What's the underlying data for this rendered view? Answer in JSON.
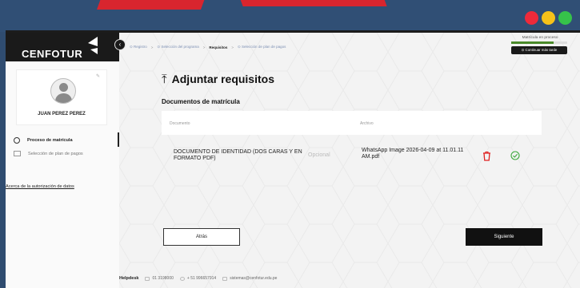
{
  "window": {
    "controls": [
      {
        "name": "close",
        "color": "#ee2a3a"
      },
      {
        "name": "minimize",
        "color": "#f6c21a"
      },
      {
        "name": "maximize",
        "color": "#36c24a"
      }
    ]
  },
  "brand": {
    "logo_text": "CENFOTUR"
  },
  "profile": {
    "name": "JUAN PEREZ PEREZ",
    "edit_glyph": "✎"
  },
  "sidebar": {
    "items": [
      {
        "label": "Proceso de matrícula",
        "icon": "circle-icon"
      },
      {
        "label": "Selección de plan de pagos",
        "icon": "grid-icon"
      }
    ],
    "link": "Acerca de la autorización de datos"
  },
  "breadcrumb": [
    {
      "label": "⊙ Registro",
      "active": false
    },
    {
      "label": "⊙ Selección del programa",
      "active": false
    },
    {
      "label": "Requisitos",
      "active": true
    },
    {
      "label": "⊙ Selección de plan de pagos",
      "active": false
    }
  ],
  "status": {
    "label": "Matrícula en proceso",
    "progress": 0.75,
    "continue_label": "⊙ Continuar más tarde"
  },
  "page": {
    "title": "Adjuntar requisitos",
    "section_title": "Documentos de matrícula"
  },
  "table": {
    "headers": {
      "document": "Documento",
      "file": "Archivo"
    },
    "rows": [
      {
        "document": "DOCUMENTO DE IDENTIDAD (DOS CARAS Y EN FORMATO PDF)",
        "optional": "Opcional",
        "file": "WhatsApp Image 2026-04-09 at 11.01.11 AM.pdf"
      }
    ]
  },
  "actions": {
    "back": "Atrás",
    "next": "Siguiente"
  },
  "helpdesk": {
    "label": "Helpdesk",
    "phone": "01 3198000",
    "whatsapp": "+ 51 996657914",
    "email": "sistemas@cenfotur.edu.pe"
  },
  "colors": {
    "accent_red": "#d8252e",
    "background_blue": "#2f4c70",
    "dark": "#111111",
    "success": "#3aa83a"
  }
}
